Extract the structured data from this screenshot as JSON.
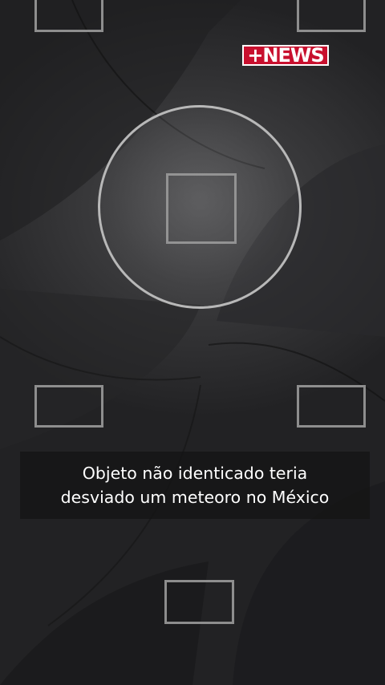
{
  "logo": {
    "text": "+NEWS",
    "color": "#c8102e"
  },
  "caption": {
    "line1": "Objeto não identicado teria",
    "line2": "desviado um meteoro no México"
  },
  "overlay": {
    "frame_boxes": [
      "top-left",
      "top-right",
      "center",
      "mid-left",
      "mid-right",
      "bottom-center"
    ],
    "focus_ring": "circle"
  }
}
